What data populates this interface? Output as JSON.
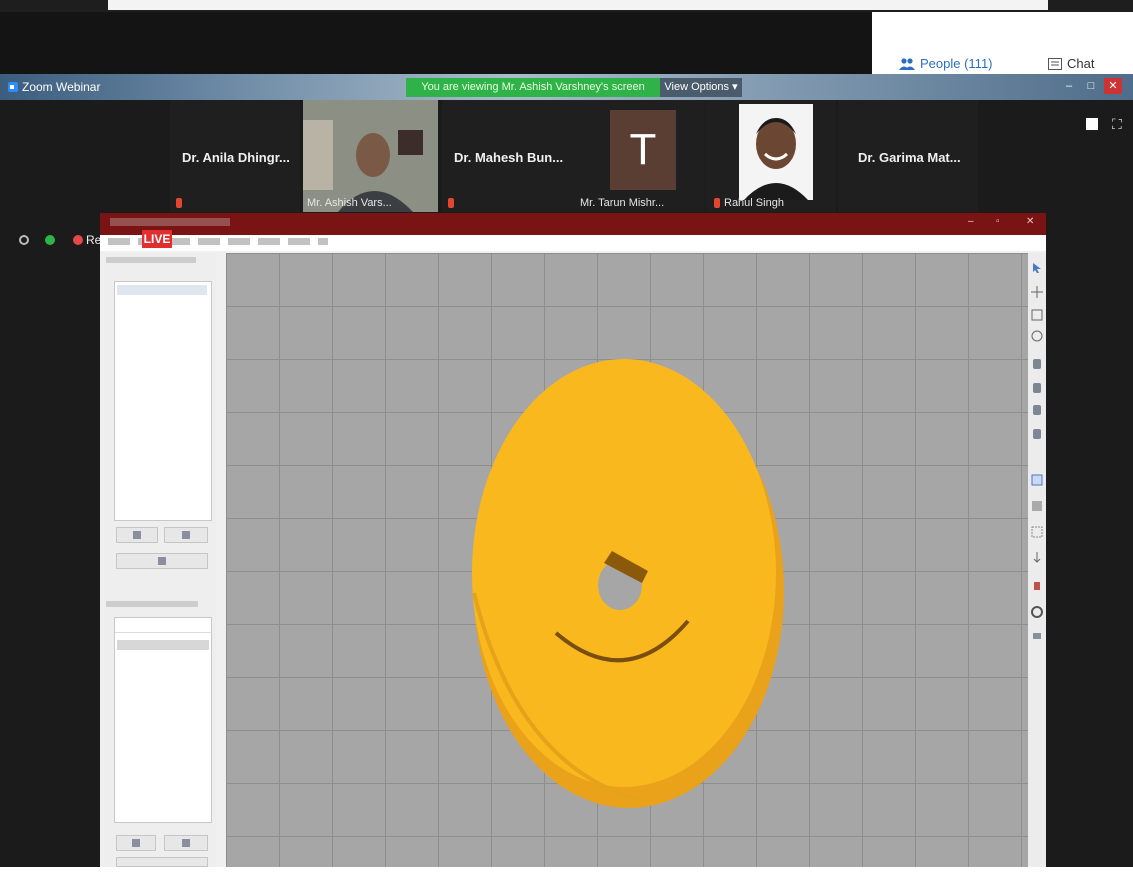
{
  "top_panel": {
    "people_label": "People (111)",
    "chat_label": "Chat"
  },
  "zoom_window": {
    "title": "Zoom Webinar",
    "share_banner": "You are viewing Mr. Ashish Varshney's screen",
    "view_options": "View Options"
  },
  "gallery": {
    "tiles": [
      {
        "name": "Dr. Anila Dhingr..."
      },
      {
        "caption": "Mr. Ashish Vars..."
      },
      {
        "name": "Dr. Mahesh Bun..."
      },
      {
        "initial": "T",
        "caption": "Mr. Tarun Mishr..."
      },
      {
        "caption": "Rahul Singh"
      },
      {
        "name": "Dr. Garima Mat..."
      }
    ],
    "left_controls_partial": "Re"
  },
  "live_badge": "LIVE",
  "colors": {
    "banner_green": "#2fb348",
    "live_red": "#e02f2f",
    "part_yellow": "#f7b81e",
    "app_titlebar": "#7a1414"
  }
}
